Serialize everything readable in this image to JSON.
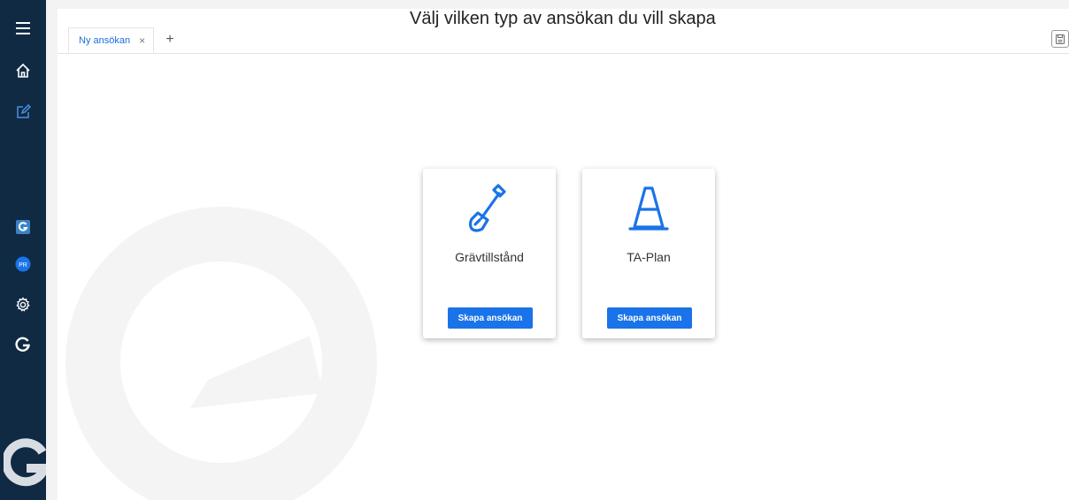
{
  "tabs": [
    {
      "label": "Ny ansökan",
      "close": "×"
    }
  ],
  "tab_add": "+",
  "heading": "Välj vilken typ av ansökan du vill skapa",
  "cards": [
    {
      "label": "Grävtillstånd",
      "icon": "shovel-icon",
      "button": "Skapa ansökan"
    },
    {
      "label": "TA-Plan",
      "icon": "traffic-cone-icon",
      "button": "Skapa ansökan"
    }
  ],
  "sidebar": {
    "items": [
      {
        "icon": "menu-icon"
      },
      {
        "icon": "home-icon"
      },
      {
        "icon": "edit-icon"
      },
      {
        "icon": "g-app-icon"
      },
      {
        "icon": "avatar",
        "initials": "PR"
      },
      {
        "icon": "settings-icon"
      },
      {
        "icon": "g-logo-icon"
      }
    ]
  },
  "colors": {
    "sidebar_bg": "#102a43",
    "accent": "#1a73e8",
    "tab_text": "#1a6fdc"
  }
}
